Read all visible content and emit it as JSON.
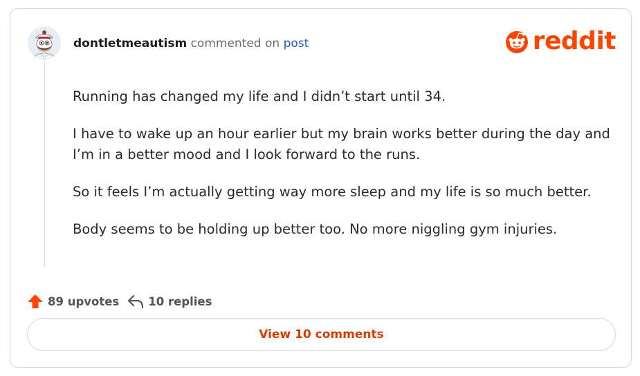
{
  "comment": {
    "username": "dontletmeautism",
    "action_text": "commented on",
    "link_text": "post",
    "avatar_icon": "snoo-avatar-icon",
    "paragraphs": [
      "Running has changed my life and I didn’t start until 34.",
      "I have to wake up an hour earlier but my brain works better during the day and I’m in a better mood and I look forward to the runs.",
      "So it feels I’m actually getting way more sleep and my life is so much better.",
      "Body seems to be holding up better too. No more niggling gym injuries."
    ]
  },
  "brand": {
    "name": "reddit",
    "color": "#ff4500"
  },
  "footer": {
    "upvotes_label": "89 upvotes",
    "replies_label": "10 replies",
    "view_button": "View 10 comments",
    "upvote_icon": "upvote-arrow-icon",
    "reply_icon": "reply-arrow-icon"
  }
}
